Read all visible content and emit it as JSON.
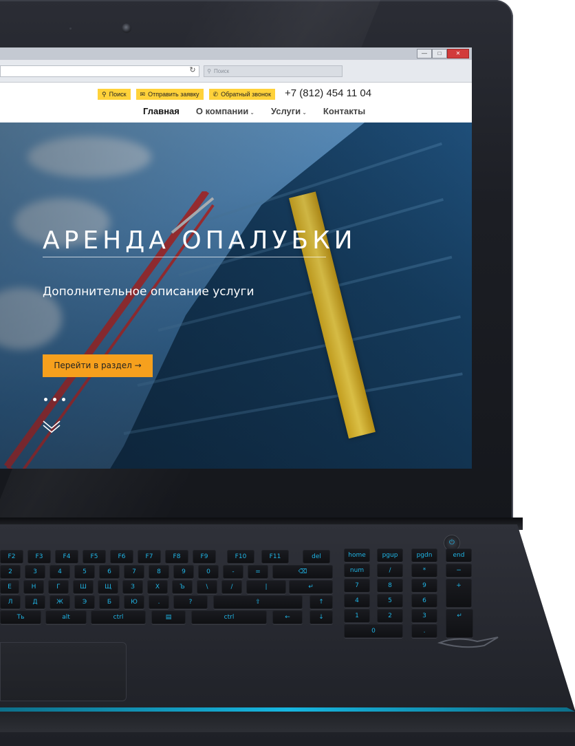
{
  "browser": {
    "search_placeholder": "Поиск",
    "window_buttons": [
      "minimize",
      "maximize",
      "close"
    ]
  },
  "header": {
    "buttons": [
      {
        "label": "Поиск",
        "icon": "search-icon"
      },
      {
        "label": "Отправить заявку",
        "icon": "mail-icon"
      },
      {
        "label": "Обратный звонок",
        "icon": "phone-icon"
      }
    ],
    "phone": "+7 (812) 454 11 04",
    "nav": [
      {
        "label": "Главная",
        "active": true,
        "has_dropdown": false
      },
      {
        "label": "О компании",
        "active": false,
        "has_dropdown": true
      },
      {
        "label": "Услуги",
        "active": false,
        "has_dropdown": true
      },
      {
        "label": "Контакты",
        "active": false,
        "has_dropdown": false
      }
    ]
  },
  "hero": {
    "title": "АРЕНДА ОПАЛУБКИ",
    "subtitle": "Дополнительное описание услуги",
    "cta_label": "Перейти в раздел →",
    "slide_count": 3
  },
  "colors": {
    "accent_yellow": "#ffd23a",
    "cta_orange": "#f6a01d",
    "keyboard_backlight": "#1fb5e6"
  }
}
